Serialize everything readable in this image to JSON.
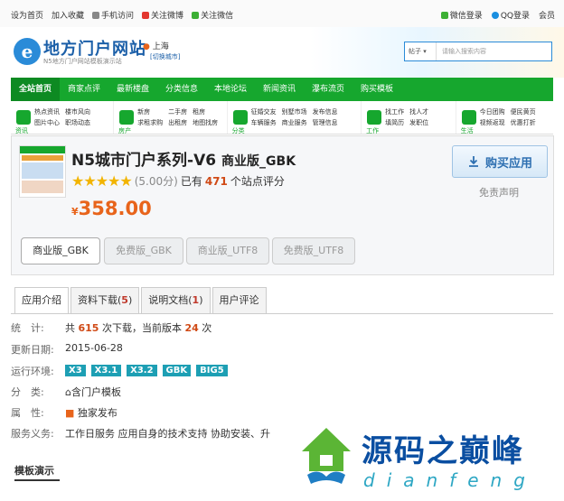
{
  "topbar": {
    "left": [
      "设为首页",
      "加入收藏",
      "手机访问",
      "关注微博",
      "关注微信"
    ],
    "right": [
      "微信登录",
      "QQ登录",
      "会员"
    ]
  },
  "header": {
    "logo_char": "e",
    "logo_title": "地方门户网站",
    "logo_sub": "N5地方门户网站模板演示站",
    "city": "上海",
    "city_switch": "[切换城市]",
    "search_select": "帖子",
    "search_placeholder": "请输入搜索内容"
  },
  "nav": [
    "全站首页",
    "商家点评",
    "最新楼盘",
    "分类信息",
    "本地论坛",
    "新闻资讯",
    "瀑布流页",
    "购买模板"
  ],
  "subnav": [
    {
      "icon_label": "资讯",
      "links": [
        "热点资讯",
        "楼市风向",
        "图片中心",
        "职场动态"
      ]
    },
    {
      "icon_label": "房产",
      "links": [
        "新房",
        "二手房",
        "租房",
        "求租求购",
        "出租房",
        "地图找房"
      ]
    },
    {
      "icon_label": "分类",
      "links": [
        "征婚交友",
        "别墅市场",
        "车辆服务",
        "商业服务",
        "发布信息",
        "管理信息"
      ]
    },
    {
      "icon_label": "工作",
      "links": [
        "找工作",
        "找人才",
        "填简历",
        "发职位"
      ]
    },
    {
      "icon_label": "生活",
      "links": [
        "今日团购",
        "便民黄页",
        "视频返现",
        "优惠打折"
      ]
    }
  ],
  "product": {
    "name": "N5城市门户系列-V6",
    "edition": "商业版_GBK",
    "stars": "★★★★★",
    "score": "(5.00分)",
    "rated_prefix": "已有",
    "rated_count": "471",
    "rated_suffix": "个站点评分",
    "currency": "¥",
    "price": "358.00",
    "buy_label": "购买应用",
    "disclaimer": "免责声明",
    "versions": [
      "商业版_GBK",
      "免费版_GBK",
      "商业版_UTF8",
      "免费版_UTF8"
    ]
  },
  "tabs": [
    {
      "label": "应用介绍",
      "count": "",
      "suffix": ""
    },
    {
      "label": "资料下载(",
      "count": "5",
      "suffix": ")"
    },
    {
      "label": "说明文档(",
      "count": "1",
      "suffix": ")"
    },
    {
      "label": "用户评论",
      "count": "",
      "suffix": ""
    }
  ],
  "info": {
    "stats_key": "统　计:",
    "stats_prefix": "共",
    "downloads": "615",
    "stats_mid": "次下载，当前版本",
    "current_version": "24",
    "stats_suffix": "次",
    "updated_key": "更新日期:",
    "updated": "2015-06-28",
    "env_key": "运行环境:",
    "env": [
      "X3",
      "X3.1",
      "X3.2",
      "GBK",
      "BIG5"
    ],
    "category_key": "分　类:",
    "category": "含门户模板",
    "attr_key": "属　性:",
    "attr": "独家发布",
    "service_key": "服务义务:",
    "service": "工作日服务  应用自身的技术支持  协助安装、升"
  },
  "demo_title": "模板演示",
  "watermark": {
    "title": "源码之巅峰",
    "pinyin": "dianfeng"
  },
  "colors": {
    "nav_green": "#16a72e",
    "price_orange": "#e8641b",
    "brand_blue": "#0a4ea1",
    "badge_teal": "#1d9fb4"
  }
}
